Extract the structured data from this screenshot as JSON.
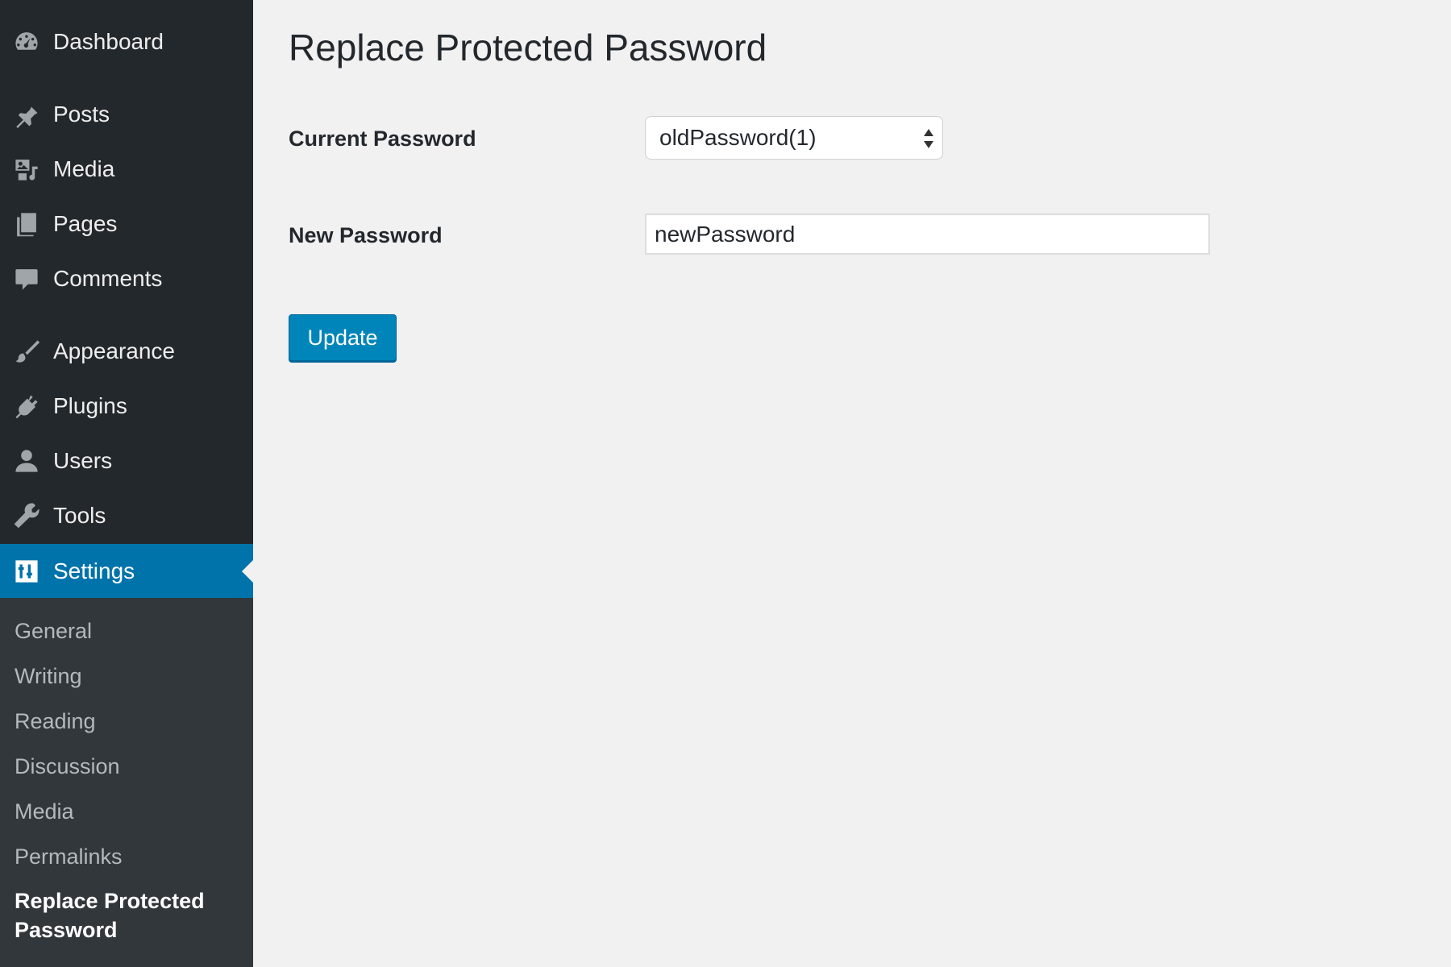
{
  "sidebar": {
    "menu": [
      {
        "label": "Dashboard",
        "icon": "dashboard-icon"
      },
      {
        "label": "Posts",
        "icon": "pin-icon"
      },
      {
        "label": "Media",
        "icon": "media-icon"
      },
      {
        "label": "Pages",
        "icon": "pages-icon"
      },
      {
        "label": "Comments",
        "icon": "comment-icon"
      },
      {
        "label": "Appearance",
        "icon": "paintbrush-icon"
      },
      {
        "label": "Plugins",
        "icon": "plugin-icon"
      },
      {
        "label": "Users",
        "icon": "user-icon"
      },
      {
        "label": "Tools",
        "icon": "wrench-icon"
      },
      {
        "label": "Settings",
        "icon": "settings-icon",
        "active": true
      }
    ],
    "submenu": [
      {
        "label": "General"
      },
      {
        "label": "Writing"
      },
      {
        "label": "Reading"
      },
      {
        "label": "Discussion"
      },
      {
        "label": "Media"
      },
      {
        "label": "Permalinks"
      },
      {
        "label": "Replace Protected Password",
        "current": true
      }
    ]
  },
  "main": {
    "title": "Replace Protected Password",
    "current_password": {
      "label": "Current Password",
      "selected": "oldPassword(1)"
    },
    "new_password": {
      "label": "New Password",
      "value": "newPassword"
    },
    "update_label": "Update"
  },
  "colors": {
    "sidebar_bg": "#23282d",
    "submenu_bg": "#32373c",
    "accent": "#0073aa",
    "button": "#0085ba",
    "page_bg": "#f1f1f1"
  }
}
